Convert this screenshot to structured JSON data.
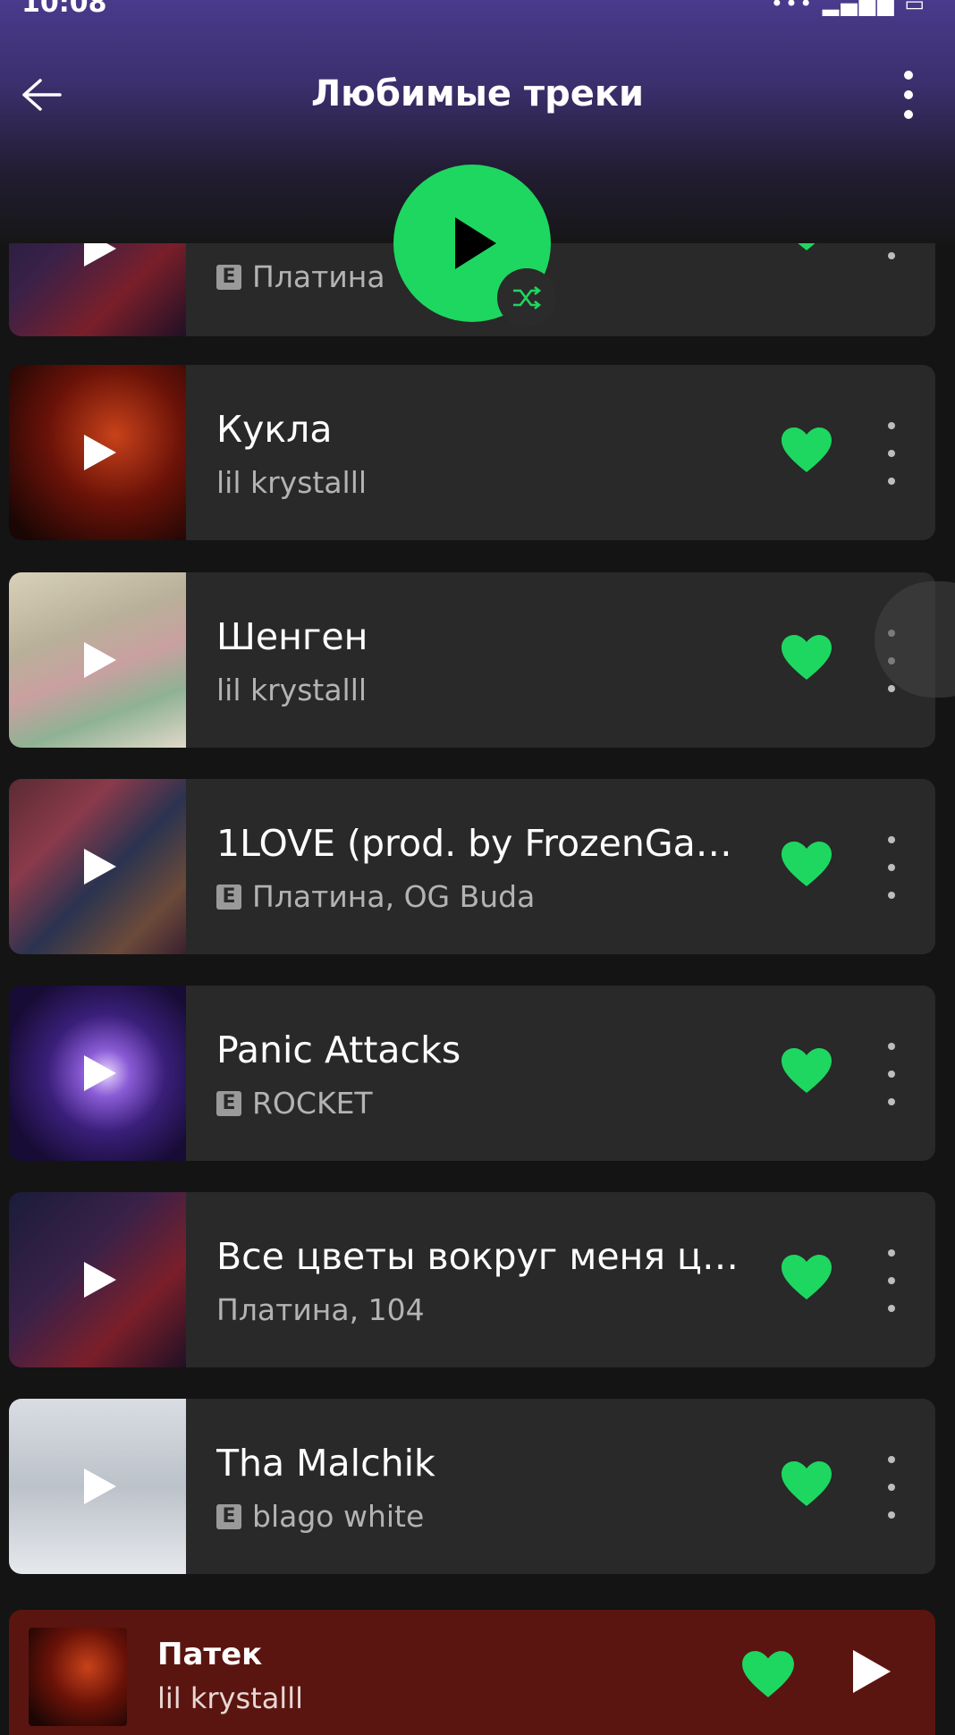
{
  "status_bar": {
    "time": "10:08",
    "icons": "••• ▂▄▆█ ▭"
  },
  "header": {
    "title": "Любимые треки",
    "back_icon": "arrow-left-icon",
    "menu_icon": "more-vertical-icon"
  },
  "colors": {
    "accent": "#1ed760",
    "card": "#292929",
    "background": "#141414",
    "mini_player": "#5b1510"
  },
  "tracks": [
    {
      "title": "",
      "explicit": true,
      "artist": "Платина",
      "liked": true
    },
    {
      "title": "Кукла",
      "explicit": false,
      "artist": "lil krystalll",
      "liked": true
    },
    {
      "title": "Шенген",
      "explicit": false,
      "artist": "lil krystalll",
      "liked": true
    },
    {
      "title": "1LOVE (prod. by FrozenGan...",
      "explicit": true,
      "artist": "Платина, OG Buda",
      "liked": true
    },
    {
      "title": "Panic Attacks",
      "explicit": true,
      "artist": "ROCKET",
      "liked": true
    },
    {
      "title": "Все цветы вокруг меня цв...",
      "explicit": false,
      "artist": "Платина, 104",
      "liked": true
    },
    {
      "title": "Tha Malchik",
      "explicit": true,
      "artist": "blago white",
      "liked": true
    }
  ],
  "explicit_label": "E",
  "now_playing": {
    "title": "Патек",
    "artist": "lil krystalll",
    "liked": true
  }
}
